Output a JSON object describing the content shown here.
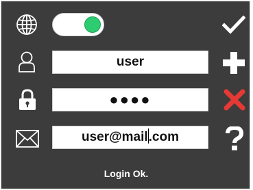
{
  "toggle": {
    "state": "on",
    "on_color": "#2ecc71"
  },
  "fields": {
    "username": {
      "value": "user"
    },
    "password": {
      "masked_value": "●●●●"
    },
    "email": {
      "value_before_caret": "user@mail",
      "value_after_caret": ".com"
    }
  },
  "actions": {
    "confirm": {
      "icon": "check-icon",
      "color": "#ffffff"
    },
    "add": {
      "icon": "plus-icon",
      "color": "#ffffff"
    },
    "cancel": {
      "icon": "close-icon",
      "color": "#e53935"
    },
    "help": {
      "icon": "question-icon",
      "color": "#ffffff"
    }
  },
  "row_icons": [
    "globe-icon",
    "user-icon",
    "lock-icon",
    "envelope-icon"
  ],
  "status": {
    "text": "Login Ok."
  },
  "colors": {
    "panel_bg": "#3c3c3c",
    "panel_border": "#d8d8d8"
  }
}
